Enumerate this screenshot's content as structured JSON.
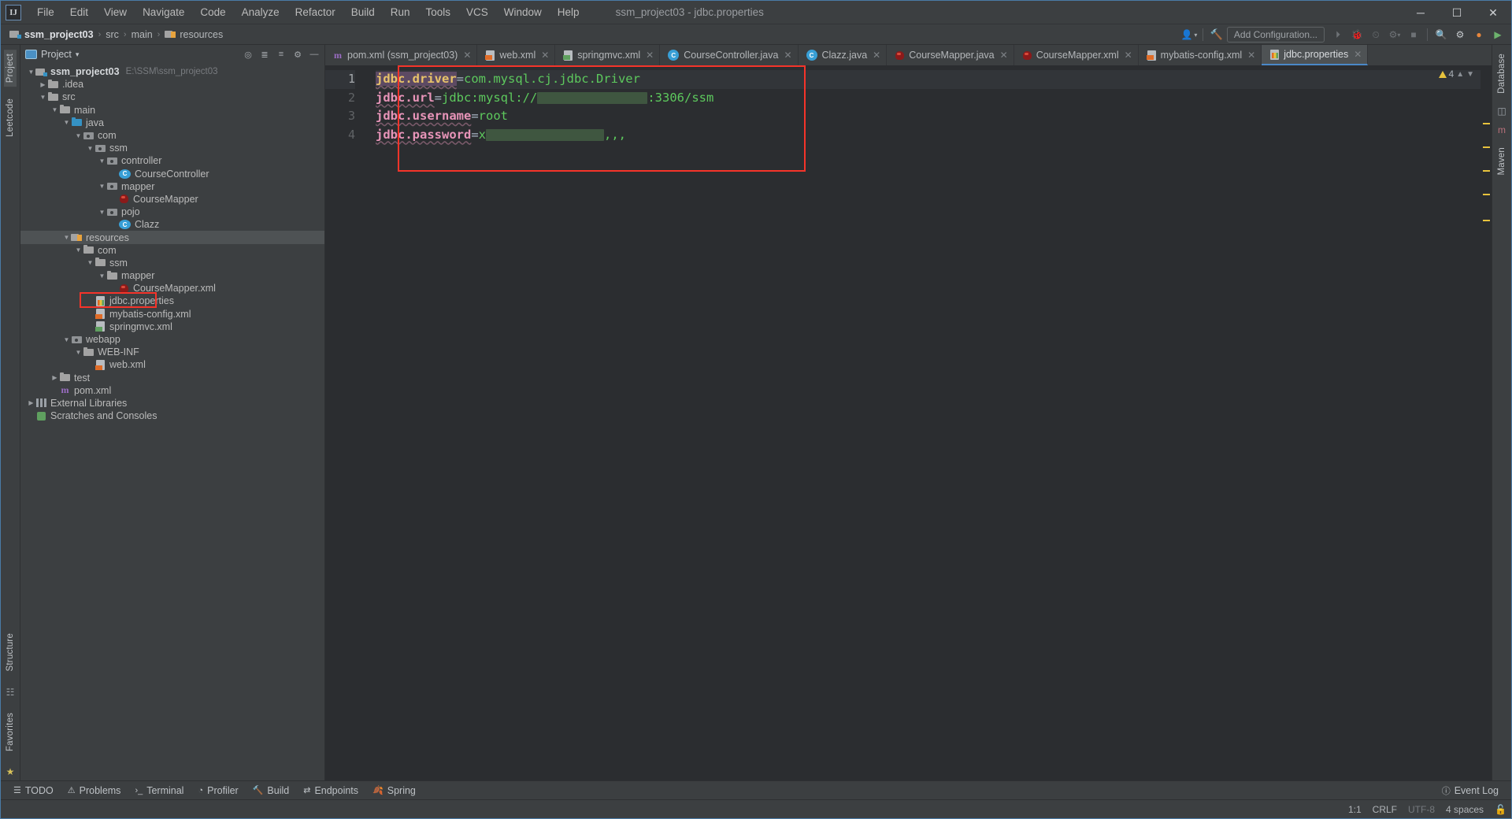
{
  "window": {
    "title": "ssm_project03 - jdbc.properties",
    "logo": "intellij-idea-logo",
    "minimize": "─",
    "maximize": "☐",
    "close": "✕"
  },
  "menu": {
    "items": [
      "File",
      "Edit",
      "View",
      "Navigate",
      "Code",
      "Analyze",
      "Refactor",
      "Build",
      "Run",
      "Tools",
      "VCS",
      "Window",
      "Help"
    ]
  },
  "navbar": {
    "breadcrumbs": [
      {
        "label": "ssm_project03",
        "icon": "module-icon",
        "bold": true
      },
      {
        "label": "src",
        "icon": "folder-icon",
        "bold": false
      },
      {
        "label": "main",
        "icon": "folder-icon",
        "bold": false
      },
      {
        "label": "resources",
        "icon": "resources-folder-icon",
        "bold": false
      }
    ],
    "separator": "›",
    "add_configuration": "Add Configuration...",
    "icons": [
      "user-avatar-icon",
      "build-hammer-icon",
      "run-icon",
      "debug-icon",
      "run-coverage-icon",
      "profiler-icon",
      "stop-icon",
      "search-icon",
      "settings-gear-icon",
      "git-update-icon"
    ]
  },
  "left_rail": {
    "top": [
      "Project",
      "Leetcode"
    ],
    "bottom": [
      "Structure",
      "Favorites"
    ],
    "active": "Project"
  },
  "right_rail": {
    "items": [
      "Database",
      "m",
      "Maven"
    ]
  },
  "project_panel": {
    "title": "Project",
    "dropdown_caret": "▾",
    "header_icons": [
      "locate-icon",
      "expand-all-icon",
      "collapse-all-icon",
      "settings-gear-icon",
      "hide-icon"
    ],
    "tree": [
      {
        "depth": 0,
        "arrow": "down",
        "icon": "module-icon",
        "label": "ssm_project03",
        "path": "E:\\SSM\\ssm_project03",
        "bold": true
      },
      {
        "depth": 1,
        "arrow": "right",
        "icon": "folder-icon",
        "label": ".idea"
      },
      {
        "depth": 1,
        "arrow": "down",
        "icon": "folder-icon",
        "label": "src"
      },
      {
        "depth": 2,
        "arrow": "down",
        "icon": "folder-icon",
        "label": "main"
      },
      {
        "depth": 3,
        "arrow": "down",
        "icon": "source-folder-icon",
        "label": "java"
      },
      {
        "depth": 4,
        "arrow": "down",
        "icon": "package-icon",
        "label": "com"
      },
      {
        "depth": 5,
        "arrow": "down",
        "icon": "package-icon",
        "label": "ssm"
      },
      {
        "depth": 6,
        "arrow": "down",
        "icon": "package-icon",
        "label": "controller"
      },
      {
        "depth": 7,
        "arrow": "none",
        "icon": "java-class-icon",
        "label": "CourseController"
      },
      {
        "depth": 6,
        "arrow": "down",
        "icon": "package-icon",
        "label": "mapper"
      },
      {
        "depth": 7,
        "arrow": "none",
        "icon": "mybatis-icon",
        "label": "CourseMapper"
      },
      {
        "depth": 6,
        "arrow": "down",
        "icon": "package-icon",
        "label": "pojo"
      },
      {
        "depth": 7,
        "arrow": "none",
        "icon": "java-class-icon",
        "label": "Clazz"
      },
      {
        "depth": 3,
        "arrow": "down",
        "icon": "resources-folder-icon",
        "label": "resources",
        "selected": true
      },
      {
        "depth": 4,
        "arrow": "down",
        "icon": "folder-icon",
        "label": "com"
      },
      {
        "depth": 5,
        "arrow": "down",
        "icon": "folder-icon",
        "label": "ssm"
      },
      {
        "depth": 6,
        "arrow": "down",
        "icon": "folder-icon",
        "label": "mapper"
      },
      {
        "depth": 7,
        "arrow": "none",
        "icon": "mybatis-icon",
        "label": "CourseMapper.xml"
      },
      {
        "depth": 5,
        "arrow": "none",
        "icon": "properties-icon",
        "label": "jdbc.properties",
        "highlighted": true
      },
      {
        "depth": 5,
        "arrow": "none",
        "icon": "xml-icon",
        "label": "mybatis-config.xml"
      },
      {
        "depth": 5,
        "arrow": "none",
        "icon": "spring-xml-icon",
        "label": "springmvc.xml"
      },
      {
        "depth": 3,
        "arrow": "down",
        "icon": "package-icon",
        "label": "webapp"
      },
      {
        "depth": 4,
        "arrow": "down",
        "icon": "folder-icon",
        "label": "WEB-INF"
      },
      {
        "depth": 5,
        "arrow": "none",
        "icon": "xml-icon",
        "label": "web.xml"
      },
      {
        "depth": 2,
        "arrow": "right",
        "icon": "folder-icon",
        "label": "test"
      },
      {
        "depth": 2,
        "arrow": "none",
        "icon": "maven-icon",
        "label": "pom.xml"
      },
      {
        "depth": 0,
        "arrow": "right",
        "icon": "libraries-icon",
        "label": "External Libraries"
      },
      {
        "depth": 0,
        "arrow": "none",
        "icon": "scratches-icon",
        "label": "Scratches and Consoles"
      }
    ]
  },
  "editor": {
    "tabs": [
      {
        "label": "pom.xml (ssm_project03)",
        "icon": "maven-icon",
        "active": false
      },
      {
        "label": "web.xml",
        "icon": "xml-icon",
        "active": false
      },
      {
        "label": "springmvc.xml",
        "icon": "spring-xml-icon",
        "active": false
      },
      {
        "label": "CourseController.java",
        "icon": "java-class-icon",
        "active": false
      },
      {
        "label": "Clazz.java",
        "icon": "java-class-icon",
        "active": false
      },
      {
        "label": "CourseMapper.java",
        "icon": "mybatis-icon",
        "active": false
      },
      {
        "label": "CourseMapper.xml",
        "icon": "mybatis-icon",
        "active": false
      },
      {
        "label": "mybatis-config.xml",
        "icon": "xml-icon",
        "active": false
      },
      {
        "label": "jdbc.properties",
        "icon": "properties-icon",
        "active": true
      }
    ],
    "tab_close": "✕",
    "line_numbers": [
      "1",
      "2",
      "3",
      "4"
    ],
    "lines": [
      {
        "key": "jdbc.driver",
        "eq": "=",
        "value": "com.mysql.cj.jdbc.Driver",
        "redacted": false,
        "selected_key": true
      },
      {
        "key": "jdbc.url",
        "eq": "=",
        "value": "jdbc:mysql://",
        "redacted": true,
        "redacted_tail": ":3306/ssm",
        "selected_key": false
      },
      {
        "key": "jdbc.username",
        "eq": "=",
        "value": "root",
        "redacted": false,
        "selected_key": false
      },
      {
        "key": "jdbc.password",
        "eq": "=",
        "value": "x",
        "redacted": true,
        "redacted_tail": ",,,",
        "selected_key": false
      }
    ],
    "inspection": {
      "count": "4",
      "icon": "warning-triangle-icon",
      "up": "⌃",
      "down": "⌄"
    }
  },
  "bottom_toolbar": {
    "items": [
      {
        "label": "TODO",
        "icon": "todo-list-icon"
      },
      {
        "label": "Problems",
        "icon": "problems-icon"
      },
      {
        "label": "Terminal",
        "icon": "terminal-icon"
      },
      {
        "label": "Profiler",
        "icon": "profiler-icon"
      },
      {
        "label": "Build",
        "icon": "build-hammer-icon"
      },
      {
        "label": "Endpoints",
        "icon": "endpoints-icon"
      },
      {
        "label": "Spring",
        "icon": "spring-leaf-icon"
      }
    ],
    "event_log": {
      "label": "Event Log",
      "icon": "event-log-icon"
    }
  },
  "statusbar": {
    "caret": "1:1",
    "line_separator": "CRLF",
    "encoding": "UTF-8",
    "indent": "4 spaces",
    "lock_icon": "read-only-lock-icon"
  },
  "colors": {
    "accent_red": "#f5342a",
    "tab_active": "#4e5254",
    "key_pink": "#e794b8",
    "value_green": "#5dc95d",
    "panel_bg": "#3c3f41",
    "editor_bg": "#2b2d30"
  }
}
